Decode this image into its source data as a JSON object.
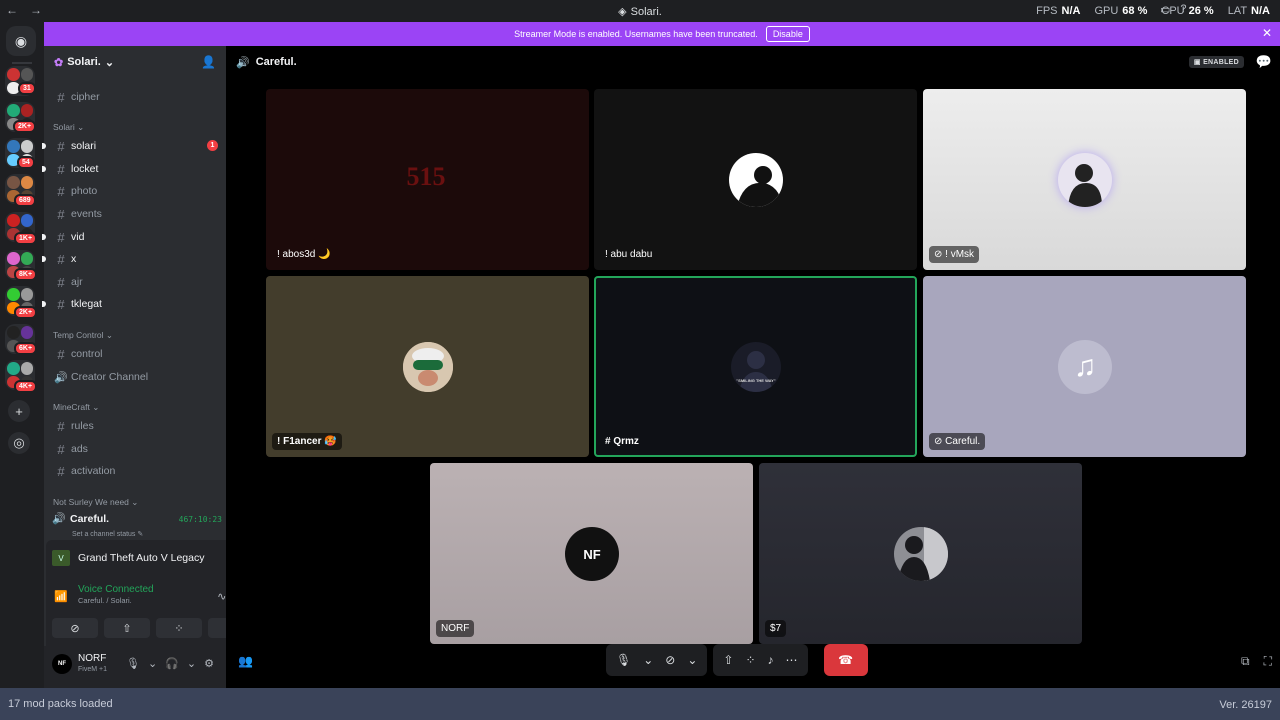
{
  "window": {
    "title": "Solari.",
    "fps_label": "FPS",
    "fps_value": "N/A",
    "gpu_label": "GPU",
    "gpu_value": "68 %",
    "cpu_label": "CPU",
    "cpu_value": "26 %",
    "lat_label": "LAT",
    "lat_value": "N/A"
  },
  "banner": {
    "text": "Streamer Mode is enabled. Usernames have been truncated.",
    "button": "Disable"
  },
  "rail": {
    "badges": [
      "31",
      "2K+",
      "54",
      "689",
      "1K+",
      "8K+",
      "2K+",
      "6K+",
      "4K+"
    ]
  },
  "server": {
    "name": "Solari.",
    "channels_top": [
      {
        "name": "cipher",
        "type": "text",
        "unread": false
      }
    ],
    "categories": [
      {
        "name": "Solari",
        "channels": [
          {
            "name": "solari",
            "type": "text",
            "unread": true,
            "mention": "1"
          },
          {
            "name": "locket",
            "type": "text",
            "unread": true
          },
          {
            "name": "photo",
            "type": "text",
            "unread": false
          },
          {
            "name": "events",
            "type": "text",
            "unread": false
          },
          {
            "name": "vid",
            "type": "text",
            "unread": true
          },
          {
            "name": "x",
            "type": "text",
            "unread": true
          },
          {
            "name": "ajr",
            "type": "text",
            "unread": false
          },
          {
            "name": "tklegat",
            "type": "text",
            "unread": true
          }
        ]
      },
      {
        "name": "Temp Control",
        "channels": [
          {
            "name": "control",
            "type": "text",
            "unread": false
          },
          {
            "name": "Creator Channel",
            "type": "voice",
            "unread": false
          }
        ]
      },
      {
        "name": "MineCraft",
        "channels": [
          {
            "name": "rules",
            "type": "text",
            "unread": false
          },
          {
            "name": "ads",
            "type": "text",
            "unread": false
          },
          {
            "name": "activation",
            "type": "text",
            "unread": false
          }
        ]
      },
      {
        "name": "Not Surley We need",
        "channels": []
      }
    ],
    "active_voice": {
      "name": "Careful.",
      "timer": "467:10:23",
      "status": "Set a channel status"
    }
  },
  "activity": {
    "game": "Grand Theft Auto V Legacy",
    "voice_title": "Voice Connected",
    "voice_sub": "Careful. / Solari."
  },
  "user": {
    "name": "NORF",
    "sub": "FiveM +1",
    "avatar_text": "NF"
  },
  "call": {
    "channel": "Careful.",
    "enabled_badge": "ENABLED",
    "tiles": [
      {
        "label": "! abos3d 🌙",
        "bg": "#1c0a0a"
      },
      {
        "label": "! abu dabu",
        "bg": "#121212"
      },
      {
        "label": "! vMsk",
        "bg": "#e6e6e6"
      },
      {
        "label": "! F1ancer 🥵",
        "bg": "#433d2c"
      },
      {
        "label": "# Qrmz",
        "bg": "#0e1015"
      },
      {
        "label": "Careful.",
        "bg": "#a8a6bd"
      },
      {
        "label": "NORF",
        "bg": "#b6aeb0"
      },
      {
        "label": "$7",
        "bg": "#2b2c34"
      }
    ],
    "tile_art_texts": {
      "abos3d": "515",
      "qrmz": "\"SMILING THE WAY\"",
      "norf": "NF"
    }
  },
  "status": {
    "left": "17 mod packs loaded",
    "right": "Ver. 26197"
  }
}
